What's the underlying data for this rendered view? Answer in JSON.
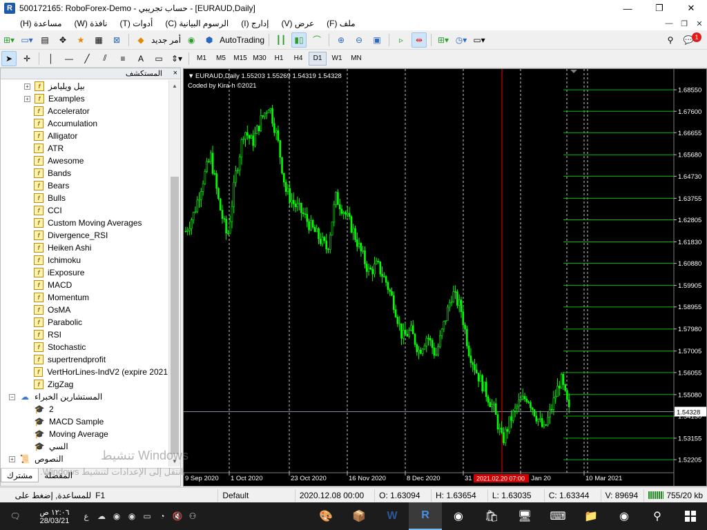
{
  "window": {
    "title": "500172165: RoboForex-Demo - حساب تجريبي - [EURAUD,Daily]",
    "logo": "R",
    "minimize": "—",
    "maximize": "❐",
    "close": "✕"
  },
  "menu": {
    "items": [
      "ملف (F)",
      "عرض (V)",
      "إدارج (I)",
      "الرسوم البيانية (C)",
      "أدوات (T)",
      "نافذة (W)",
      "مساعدة (H)"
    ],
    "mdi_minimize": "—",
    "mdi_restore": "❐",
    "mdi_close": "✕"
  },
  "toolbar": {
    "new_order_label": "أمر جديد",
    "autotrading_label": "AutoTrading",
    "notification_count": "1"
  },
  "timeframes": [
    "M1",
    "M5",
    "M15",
    "M30",
    "H1",
    "H4",
    "D1",
    "W1",
    "MN"
  ],
  "active_timeframe": "D1",
  "navigator": {
    "title": "المستكشف",
    "close": "×",
    "items": [
      {
        "label": "بيل ويليامز",
        "type": "folder"
      },
      {
        "label": "Examples",
        "type": "folder"
      },
      {
        "label": "Accelerator",
        "type": "indicator"
      },
      {
        "label": "Accumulation",
        "type": "indicator"
      },
      {
        "label": "Alligator",
        "type": "indicator"
      },
      {
        "label": "ATR",
        "type": "indicator"
      },
      {
        "label": "Awesome",
        "type": "indicator"
      },
      {
        "label": "Bands",
        "type": "indicator"
      },
      {
        "label": "Bears",
        "type": "indicator"
      },
      {
        "label": "Bulls",
        "type": "indicator"
      },
      {
        "label": "CCI",
        "type": "indicator"
      },
      {
        "label": "Custom Moving Averages",
        "type": "indicator"
      },
      {
        "label": "Divergence_RSI",
        "type": "indicator"
      },
      {
        "label": "Heiken Ashi",
        "type": "indicator"
      },
      {
        "label": "Ichimoku",
        "type": "indicator"
      },
      {
        "label": "iExposure",
        "type": "indicator"
      },
      {
        "label": "MACD",
        "type": "indicator"
      },
      {
        "label": "Momentum",
        "type": "indicator"
      },
      {
        "label": "OsMA",
        "type": "indicator"
      },
      {
        "label": "Parabolic",
        "type": "indicator"
      },
      {
        "label": "RSI",
        "type": "indicator"
      },
      {
        "label": "Stochastic",
        "type": "indicator"
      },
      {
        "label": "supertrendprofit",
        "type": "indicator"
      },
      {
        "label": "VertHorLines-IndV2 (expire 2021",
        "type": "indicator"
      },
      {
        "label": "ZigZag",
        "type": "indicator"
      },
      {
        "label": "المستشارين الخبراء",
        "type": "ea-folder"
      },
      {
        "label": "2",
        "type": "ea"
      },
      {
        "label": "MACD Sample",
        "type": "ea"
      },
      {
        "label": "Moving Average",
        "type": "ea"
      },
      {
        "label": "السي",
        "type": "ea"
      },
      {
        "label": "النصوص",
        "type": "scripts-folder"
      }
    ],
    "tabs": [
      "مشترك",
      "المفضلة"
    ]
  },
  "watermark": {
    "line1": "تنشيط Windows",
    "line2": "انتقل إلى الإعدادات لتنشيط Windows."
  },
  "chart": {
    "symbol_line": "EURAUD,Daily  1.55203 1.55269 1.54319 1.54328",
    "credit": "Coded by Kira-h ©2021",
    "current_price": "1.54328",
    "crosshair_date": "2021.02.20 07:00",
    "background": "#000000",
    "candle_color": "#00ff00",
    "grid_line_color": "#00c000",
    "vline_color": "#ff0000",
    "y_ticks": [
      "1.68550",
      "1.67600",
      "1.66655",
      "1.65680",
      "1.64730",
      "1.63755",
      "1.62805",
      "1.61830",
      "1.60880",
      "1.59905",
      "1.58955",
      "1.57980",
      "1.57005",
      "1.56055",
      "1.55080",
      "1.54130",
      "1.53155",
      "1.52205"
    ],
    "x_ticks": [
      "9 Sep 2020",
      "1 Oct 2020",
      "23 Oct 2020",
      "16 Nov 2020",
      "8 Dec 2020",
      "31 Dec 2020",
      "25 Jan 20",
      "10 Mar 2021"
    ]
  },
  "chart_data": {
    "type": "candlestick",
    "title": "EURAUD,Daily",
    "ylim": [
      1.5175,
      1.6895
    ],
    "grid": false,
    "close_approx": [
      1.623,
      1.631,
      1.645,
      1.656,
      1.635,
      1.62,
      1.648,
      1.668,
      1.662,
      1.672,
      1.679,
      1.664,
      1.641,
      1.635,
      1.631,
      1.625,
      1.62,
      1.615,
      1.638,
      1.632,
      1.624,
      1.614,
      1.605,
      1.608,
      1.601,
      1.591,
      1.576,
      1.579,
      1.57,
      1.577,
      1.568,
      1.582,
      1.596,
      1.589,
      1.57,
      1.56,
      1.552,
      1.544,
      1.53,
      1.54,
      1.547,
      1.55,
      1.542,
      1.535,
      1.546,
      1.558,
      1.5433
    ],
    "open": 1.55203,
    "high": 1.55269,
    "low": 1.54319,
    "close": 1.54328
  },
  "status": {
    "help": "للمساعدة, إضغط على",
    "f1": "F1",
    "profile": "Default",
    "datetime": "2020.12.08 00:00",
    "open": "O: 1.63094",
    "high": "H: 1.63654",
    "low": "L: 1.63035",
    "close": "C: 1.63344",
    "volume": "V: 89694",
    "traffic": "755/20 kb"
  },
  "taskbar": {
    "time": "١٢:٠٦ ص",
    "date": "28/03/21",
    "lang": "ع"
  }
}
